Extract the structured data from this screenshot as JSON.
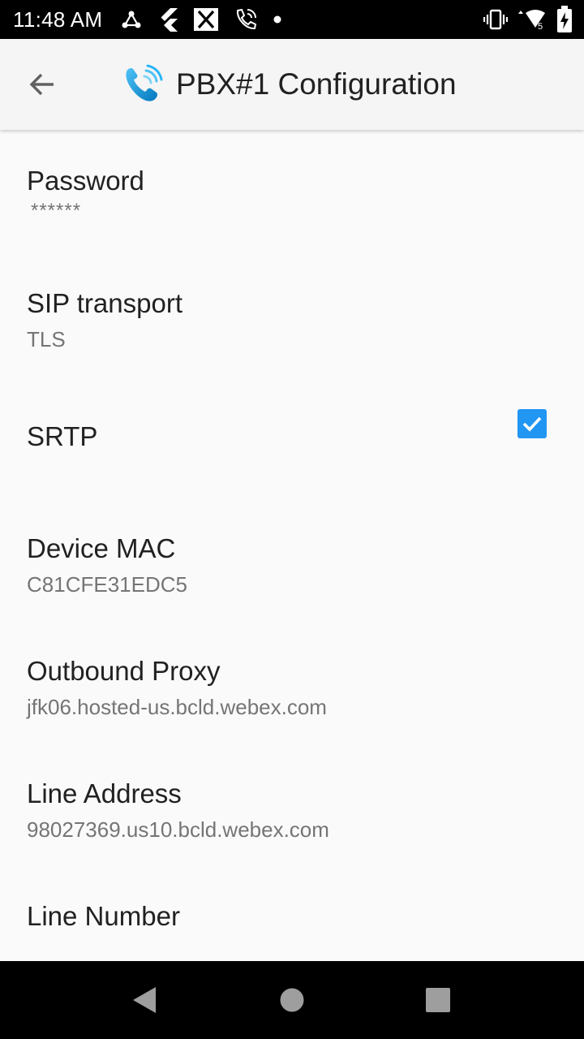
{
  "status_bar": {
    "time": "11:48 AM",
    "left_icons": [
      "webhook-icon",
      "flutter-icon",
      "x-box-icon",
      "wifi-calling-icon",
      "dot-icon"
    ],
    "right_icons": [
      "vibrate-icon",
      "wifi-icon",
      "battery-icon"
    ]
  },
  "app_bar": {
    "title": "PBX#1 Configuration",
    "back_icon": "arrow-back-icon",
    "logo_icon": "phone-signal-icon"
  },
  "preferences": [
    {
      "title": "Password",
      "summary": "******"
    },
    {
      "title": "SIP transport",
      "summary": "TLS"
    },
    {
      "title": "SRTP",
      "checked": true
    },
    {
      "title": "Device MAC",
      "summary": "C81CFE31EDC5"
    },
    {
      "title": "Outbound Proxy",
      "summary": "jfk06.hosted-us.bcld.webex.com"
    },
    {
      "title": "Line Address",
      "summary": "98027369.us10.bcld.webex.com"
    },
    {
      "title": "Line Number",
      "summary": ""
    }
  ],
  "nav_bar": {
    "back": "nav-back-icon",
    "home": "nav-home-icon",
    "recents": "nav-recents-icon"
  },
  "colors": {
    "accent": "#2196f3",
    "background": "#fafafa",
    "app_bar": "#f5f5f5",
    "title_text": "#212121",
    "summary_text": "#757575"
  }
}
